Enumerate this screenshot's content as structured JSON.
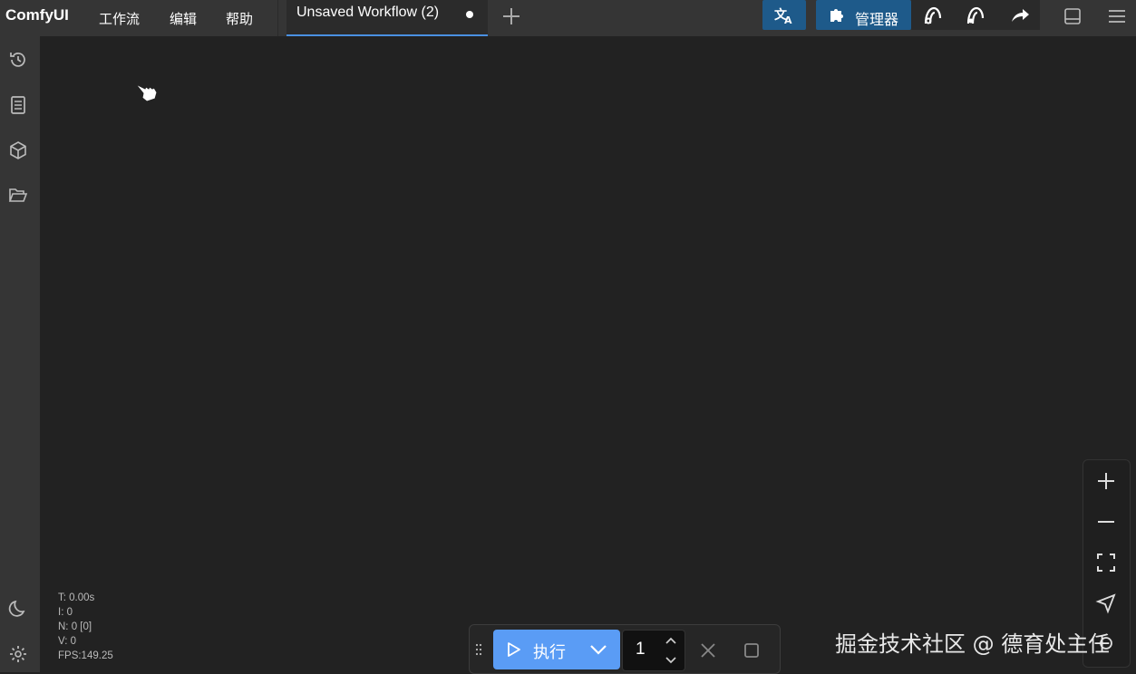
{
  "app": {
    "name": "ComfyUI"
  },
  "menu": [
    {
      "label": "工作流"
    },
    {
      "label": "编辑"
    },
    {
      "label": "帮助"
    }
  ],
  "tab": {
    "title": "Unsaved Workflow (2)",
    "unsaved": true
  },
  "toolbar": {
    "manager_label": "管理器"
  },
  "stats": {
    "t": "T: 0.00s",
    "i": "I: 0",
    "n": "N: 0 [0]",
    "v": "V: 0",
    "fps": "FPS:149.25"
  },
  "run": {
    "label": "执行",
    "count": "1"
  },
  "watermark": "掘金技术社区 @ 德育处主任",
  "colors": {
    "topbar": "#353535",
    "canvas": "#222222",
    "accent": "#5a9cf5",
    "manager": "#1e5a8a",
    "tab_underline": "#4a90e2"
  }
}
